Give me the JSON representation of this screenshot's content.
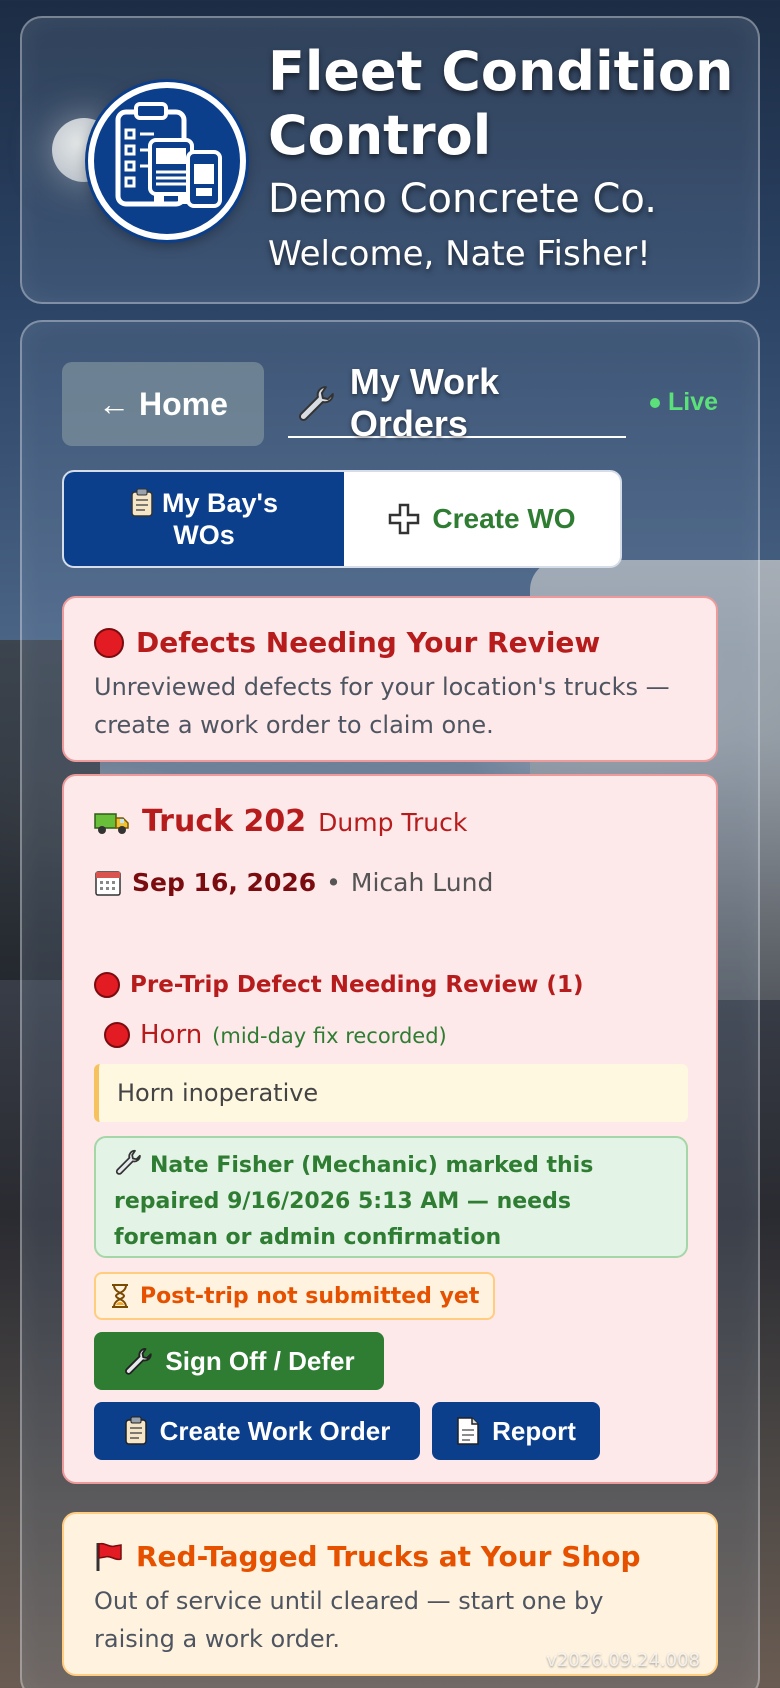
{
  "header": {
    "title": "Fleet Condition Control",
    "company": "Demo Concrete Co.",
    "welcome": "Welcome, Nate Fisher!"
  },
  "nav": {
    "home_label": "← Home",
    "page_tab_label": "My Work Orders",
    "live_label": "Live"
  },
  "segments": {
    "my_bay_line1": "My Bay's",
    "my_bay_line2": "WOs",
    "create_label": "Create WO"
  },
  "defects_section": {
    "title": "Defects Needing Your Review",
    "description": "Unreviewed defects for your location's trucks — create a work order to claim one."
  },
  "truck_card": {
    "truck_name": "Truck 202",
    "truck_type": "Dump Truck",
    "date": "Sep 16, 2026",
    "separator": "•",
    "driver": "Micah Lund",
    "section_title": "Pre-Trip Defect Needing Review (1)",
    "defect_name": "Horn",
    "defect_note": "(mid-day fix recorded)",
    "defect_comment": "Horn inoperative",
    "repair_message": "Nate Fisher (Mechanic) marked this repaired 9/16/2026 5:13 AM — needs foreman or admin confirmation",
    "post_trip_status": "Post-trip not submitted yet",
    "signoff_label": "Sign Off / Defer",
    "create_wo_label": "Create Work Order",
    "report_label": "Report"
  },
  "red_tag_section": {
    "title": "Red-Tagged Trucks at Your Shop",
    "description": "Out of service until cleared — start one by raising a work order."
  },
  "version": "v2026.09.24.008",
  "colors": {
    "brand_blue": "#0b3f8c",
    "success_green": "#2e7d32",
    "danger_red": "#b71c1c",
    "warning_orange": "#e65100",
    "live_green": "#5be07a"
  }
}
